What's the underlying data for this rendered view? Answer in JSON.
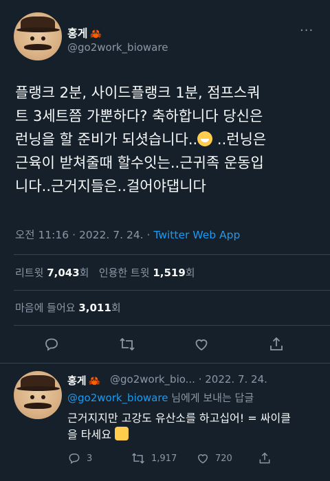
{
  "tweet": {
    "author_name": "홍게",
    "author_emoji": "🦀",
    "author_handle": "@go2work_bioware",
    "more_label": "···",
    "text_line1": "플랭크 2분, 사이드플랭크 1분, 점프스쿼",
    "text_line2": "트 3세트쯤 가뿐하다? 축하합니다 당신은",
    "text_line3a": "런닝을 할 준비가 되셧습니다..",
    "text_line3b": "..런닝은",
    "text_line4": "근육이 받쳐줄때 할수잇는..근귀족 운동입",
    "text_line5": "니다..근거지들은..걸어야댑니다",
    "time": "오전 11:16",
    "sep": "·",
    "date": "2022. 7. 24.",
    "source": "Twitter Web App",
    "retweets_count": "7,043",
    "retweets_label": "리트윗",
    "retweets_unit": "회",
    "quotes_label": "인용한 트윗",
    "quotes_count": "1,519",
    "quotes_unit": "회",
    "likes_label": "마음에 들어요",
    "likes_count": "3,011",
    "likes_unit": "회"
  },
  "reply": {
    "author_name": "홍게",
    "author_emoji": "🦀",
    "meta": "@go2work_bio... · 2022. 7. 24.",
    "mention": "@go2work_bioware",
    "replying_suffix": " 님에게 보내는 답글",
    "text_line1": "근거지지만 고강도 유산소를 하고십어! = 싸이클",
    "text_line2": "을 타세요",
    "reply_count": "3",
    "retweet_count": "1,917",
    "like_count": "720"
  },
  "colors": {
    "background": "#15202b",
    "accent": "#1d9bf0",
    "muted": "#8b98a5"
  }
}
